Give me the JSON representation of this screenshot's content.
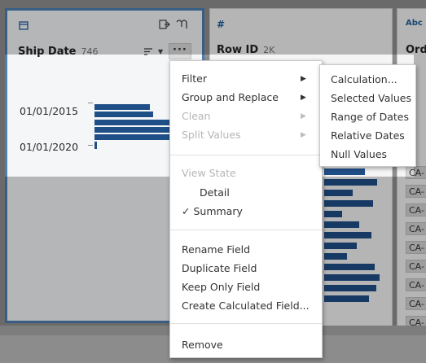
{
  "cards": [
    {
      "type_icon": "calendar-icon",
      "title": "Ship Date",
      "count": "746"
    },
    {
      "type_icon": "#",
      "title": "Row ID",
      "count": "2K"
    },
    {
      "type_icon": "Abc",
      "title": "Ord"
    }
  ],
  "ship_date": {
    "ticks": [
      "01/01/2015",
      "01/01/2020"
    ]
  },
  "order_id_cells": [
    "CA-",
    "CA-",
    "CA-",
    "CA-",
    "CA-",
    "CA-",
    "CA-",
    "CA-",
    "CA-",
    "CA-"
  ],
  "menu": {
    "filter": "Filter",
    "group_replace": "Group and Replace",
    "clean": "Clean",
    "split_values": "Split Values",
    "view_state": "View State",
    "detail": "Detail",
    "summary": "Summary",
    "checkmark": "✓",
    "rename": "Rename Field",
    "duplicate": "Duplicate Field",
    "keep_only": "Keep Only Field",
    "create_calc": "Create Calculated Field...",
    "remove": "Remove"
  },
  "submenu": {
    "calculation": "Calculation...",
    "selected_values": "Selected Values",
    "range_of_dates": "Range of Dates",
    "relative_dates": "Relative Dates",
    "null_values": "Null Values"
  },
  "colors": {
    "accent": "#4e7fb2",
    "bars": "#1f4f87"
  }
}
